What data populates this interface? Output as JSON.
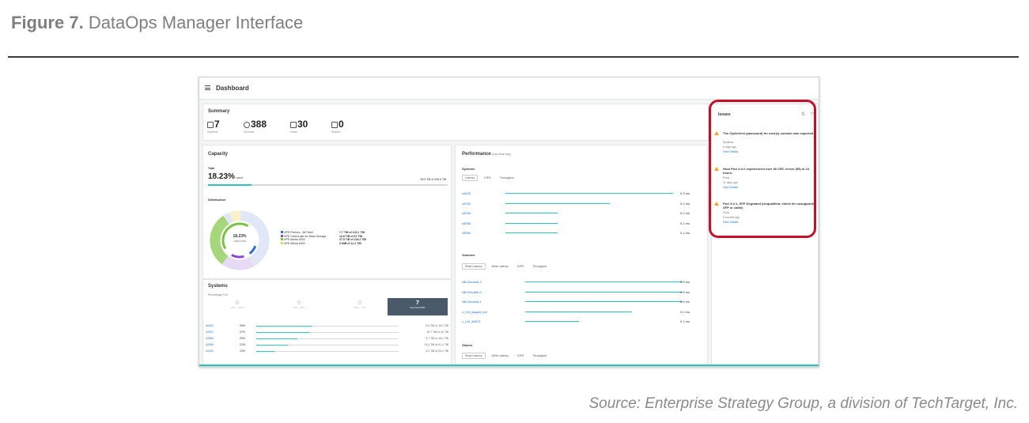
{
  "figure": {
    "label": "Figure 7.",
    "title": "DataOps Manager Interface",
    "source": "Source: Enterprise Strategy Group, a division of TechTarget, Inc."
  },
  "app": {
    "page_title": "Dashboard"
  },
  "summary": {
    "title": "Summary",
    "stats": [
      {
        "icon": "systems-icon",
        "value": "7",
        "label": "Systems"
      },
      {
        "icon": "volumes-icon",
        "value": "388",
        "label": "Volumes"
      },
      {
        "icon": "hosts-icon",
        "value": "30",
        "label": "Hosts"
      },
      {
        "icon": "shares-icon",
        "value": "0",
        "label": "Shares"
      }
    ]
  },
  "capacity": {
    "title": "Capacity",
    "total_label": "Total",
    "used_pct": "18.23%",
    "used_word": "used",
    "used_fraction": 0.1823,
    "total_text": "55.9 TiB of 306.6 TiB",
    "distribution_label": "Distribution",
    "donut_center_value": "18.23%",
    "donut_center_label": "Used total",
    "legend": [
      {
        "name": "HPE Primera - All Flash",
        "value": "7.7 TiB of 123.1 TiB",
        "color": "#2f6fd1"
      },
      {
        "name": "HPE GreenLake for Block Storage",
        "value": "10.6 TiB of 67 TiB",
        "color": "#8a48d6"
      },
      {
        "name": "HPE Alletra 9000",
        "value": "37.5 TiB of 126.2 TiB",
        "color": "#7ac142"
      },
      {
        "name": "HPE Alletra 6000",
        "value": "0 MiB of 11.2 TiB",
        "color": "#f2d64b"
      }
    ]
  },
  "systems": {
    "title": "Systems",
    "subtitle": "Percentage Full",
    "buckets": [
      {
        "value": "0",
        "label": "90% - 100%"
      },
      {
        "value": "0",
        "label": "75% - 89%"
      },
      {
        "value": "0",
        "label": "50% - 74%"
      },
      {
        "value": "7",
        "label": "less than 50%"
      }
    ],
    "rows": [
      {
        "name": "s6432",
        "pct": "39%",
        "fill": 0.39,
        "cap": "6.6 TiB of 16.1 TiB"
      },
      {
        "name": "s3292",
        "pct": "37%",
        "fill": 0.37,
        "cap": "15.7 TiB of 42 TiB"
      },
      {
        "name": "s3058",
        "pct": "29%",
        "fill": 0.29,
        "cap": "4.7 TiB of 16.1 TiB"
      },
      {
        "name": "s3296",
        "pct": "22%",
        "fill": 0.22,
        "cap": "13.6 TiB of 61.1 TiB"
      },
      {
        "name": "s4433",
        "pct": "13%",
        "fill": 0.13,
        "cap": "4.2 TiB of 33.1 TiB"
      }
    ]
  },
  "performance": {
    "title": "Performance",
    "subtitle": "(Last hour avg)",
    "systems": {
      "title": "Systems",
      "tabs": [
        "Latency",
        "IOPS",
        "Throughput"
      ],
      "rows": [
        {
          "name": "s4433",
          "value": "0.3 ms",
          "fill": 0.9
        },
        {
          "name": "s3292",
          "value": "0.2 ms",
          "fill": 0.56
        },
        {
          "name": "s3296",
          "value": "0.1 ms",
          "fill": 0.28
        },
        {
          "name": "s3058",
          "value": "0.1 ms",
          "fill": 0.28
        },
        {
          "name": "s3060",
          "value": "0.1 ms",
          "fill": 0.28
        }
      ]
    },
    "volumes": {
      "title": "Volumes",
      "tabs": [
        "Read Latency",
        "Write Latency",
        "IOPS",
        "Throughput"
      ],
      "rows": [
        {
          "name": "NB-Ora-drill-2",
          "value": "0.3 ms",
          "fill": 0.97
        },
        {
          "name": "NB-Ora-drill-0",
          "value": "0.3 ms",
          "fill": 0.97
        },
        {
          "name": "NB-Ora-drill-1",
          "value": "0.3 ms",
          "fill": 0.97
        },
        {
          "name": "c_LM_staged_sv1",
          "value": "0.2 ms",
          "fill": 0.66
        },
        {
          "name": "c_LM_4N021",
          "value": "0.1 ms",
          "fill": 0.33
        }
      ]
    },
    "shares": {
      "title": "Shares",
      "tabs": [
        "Read Latency",
        "Write Latency",
        "IOPS",
        "Throughput"
      ]
    }
  },
  "issues": {
    "title": "Issues",
    "items": [
      {
        "text": "The Ciphertext (password) for user(s) console was exported.",
        "category": "Systems",
        "age": "8 days ago",
        "link": "View Details"
      },
      {
        "text": "Host Port 3:4:2 experienced over 50 CRC errors (55) in 24 hours.",
        "category": "Ports",
        "age": "11 days ago",
        "link": "View Details"
      },
      {
        "text": "Port 3:2:1, SFP Degraded (Unqualified, check for unsupported SFP or cable)",
        "category": "Ports",
        "age": "6 months ago",
        "link": "View Details"
      }
    ]
  }
}
